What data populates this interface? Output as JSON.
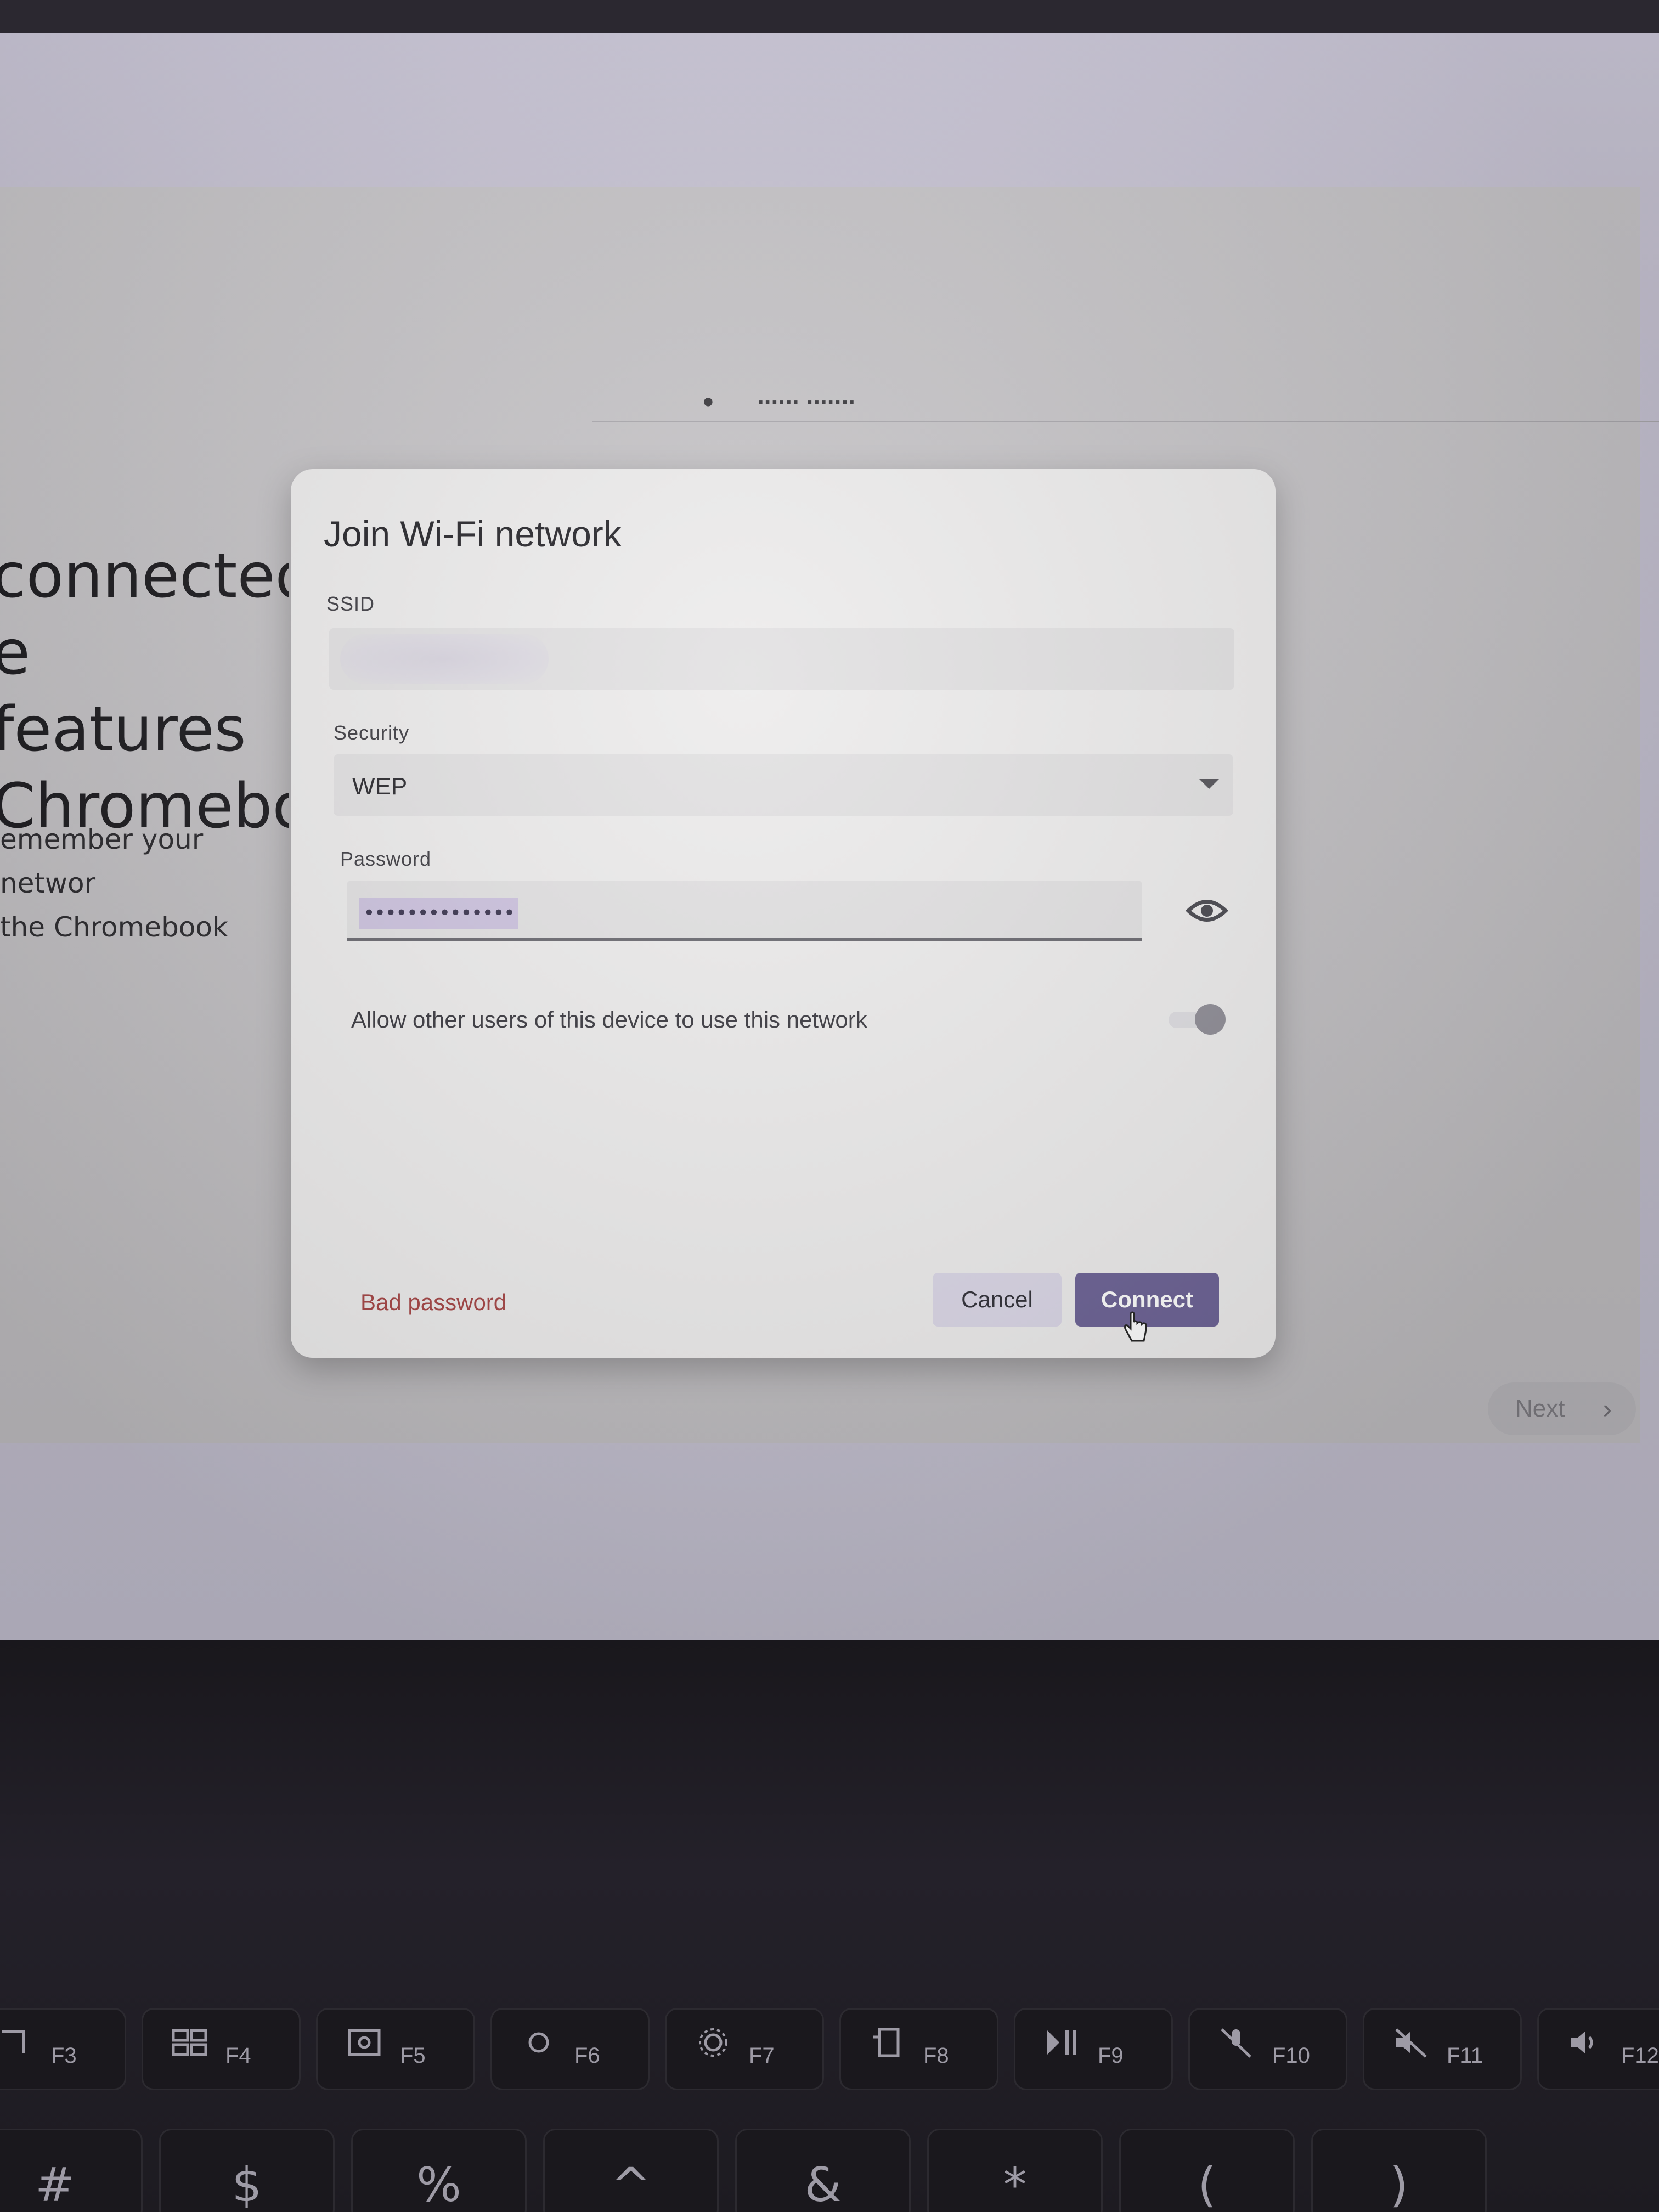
{
  "background_page": {
    "title": "connected\ne features\nChromebo",
    "description": "emember your networ\nthe Chromebook",
    "network_name": "...... .......",
    "next_label": "Next"
  },
  "dialog": {
    "title": "Join Wi-Fi network",
    "ssid_label": "SSID",
    "ssid_value": "",
    "security_label": "Security",
    "security_value": "WEP",
    "password_label": "Password",
    "password_value": "••••••••••••••",
    "share_label": "Allow other users of this device to use this network",
    "share_enabled": false,
    "status_text": "Bad password",
    "cancel_label": "Cancel",
    "connect_label": "Connect",
    "colors": {
      "primary": "#6c6295",
      "error": "#a54545",
      "secondary_button": "#dbd7e7"
    }
  },
  "keyboard": {
    "function_keys": [
      "F3",
      "F4",
      "F5",
      "F6",
      "F7",
      "F8",
      "F9",
      "F10",
      "F11",
      "F12"
    ],
    "number_row_symbols": [
      "#",
      "$",
      "%",
      "^",
      "&",
      "*",
      "(",
      ")"
    ],
    "function_key_icons": [
      "back-icon",
      "overview-icon",
      "screenshot-icon",
      "brightness-down-icon",
      "brightness-up-icon",
      "privacy-screen-icon",
      "play-pause-icon",
      "mic-mute-icon",
      "volume-mute-icon",
      "volume-up-icon"
    ]
  }
}
